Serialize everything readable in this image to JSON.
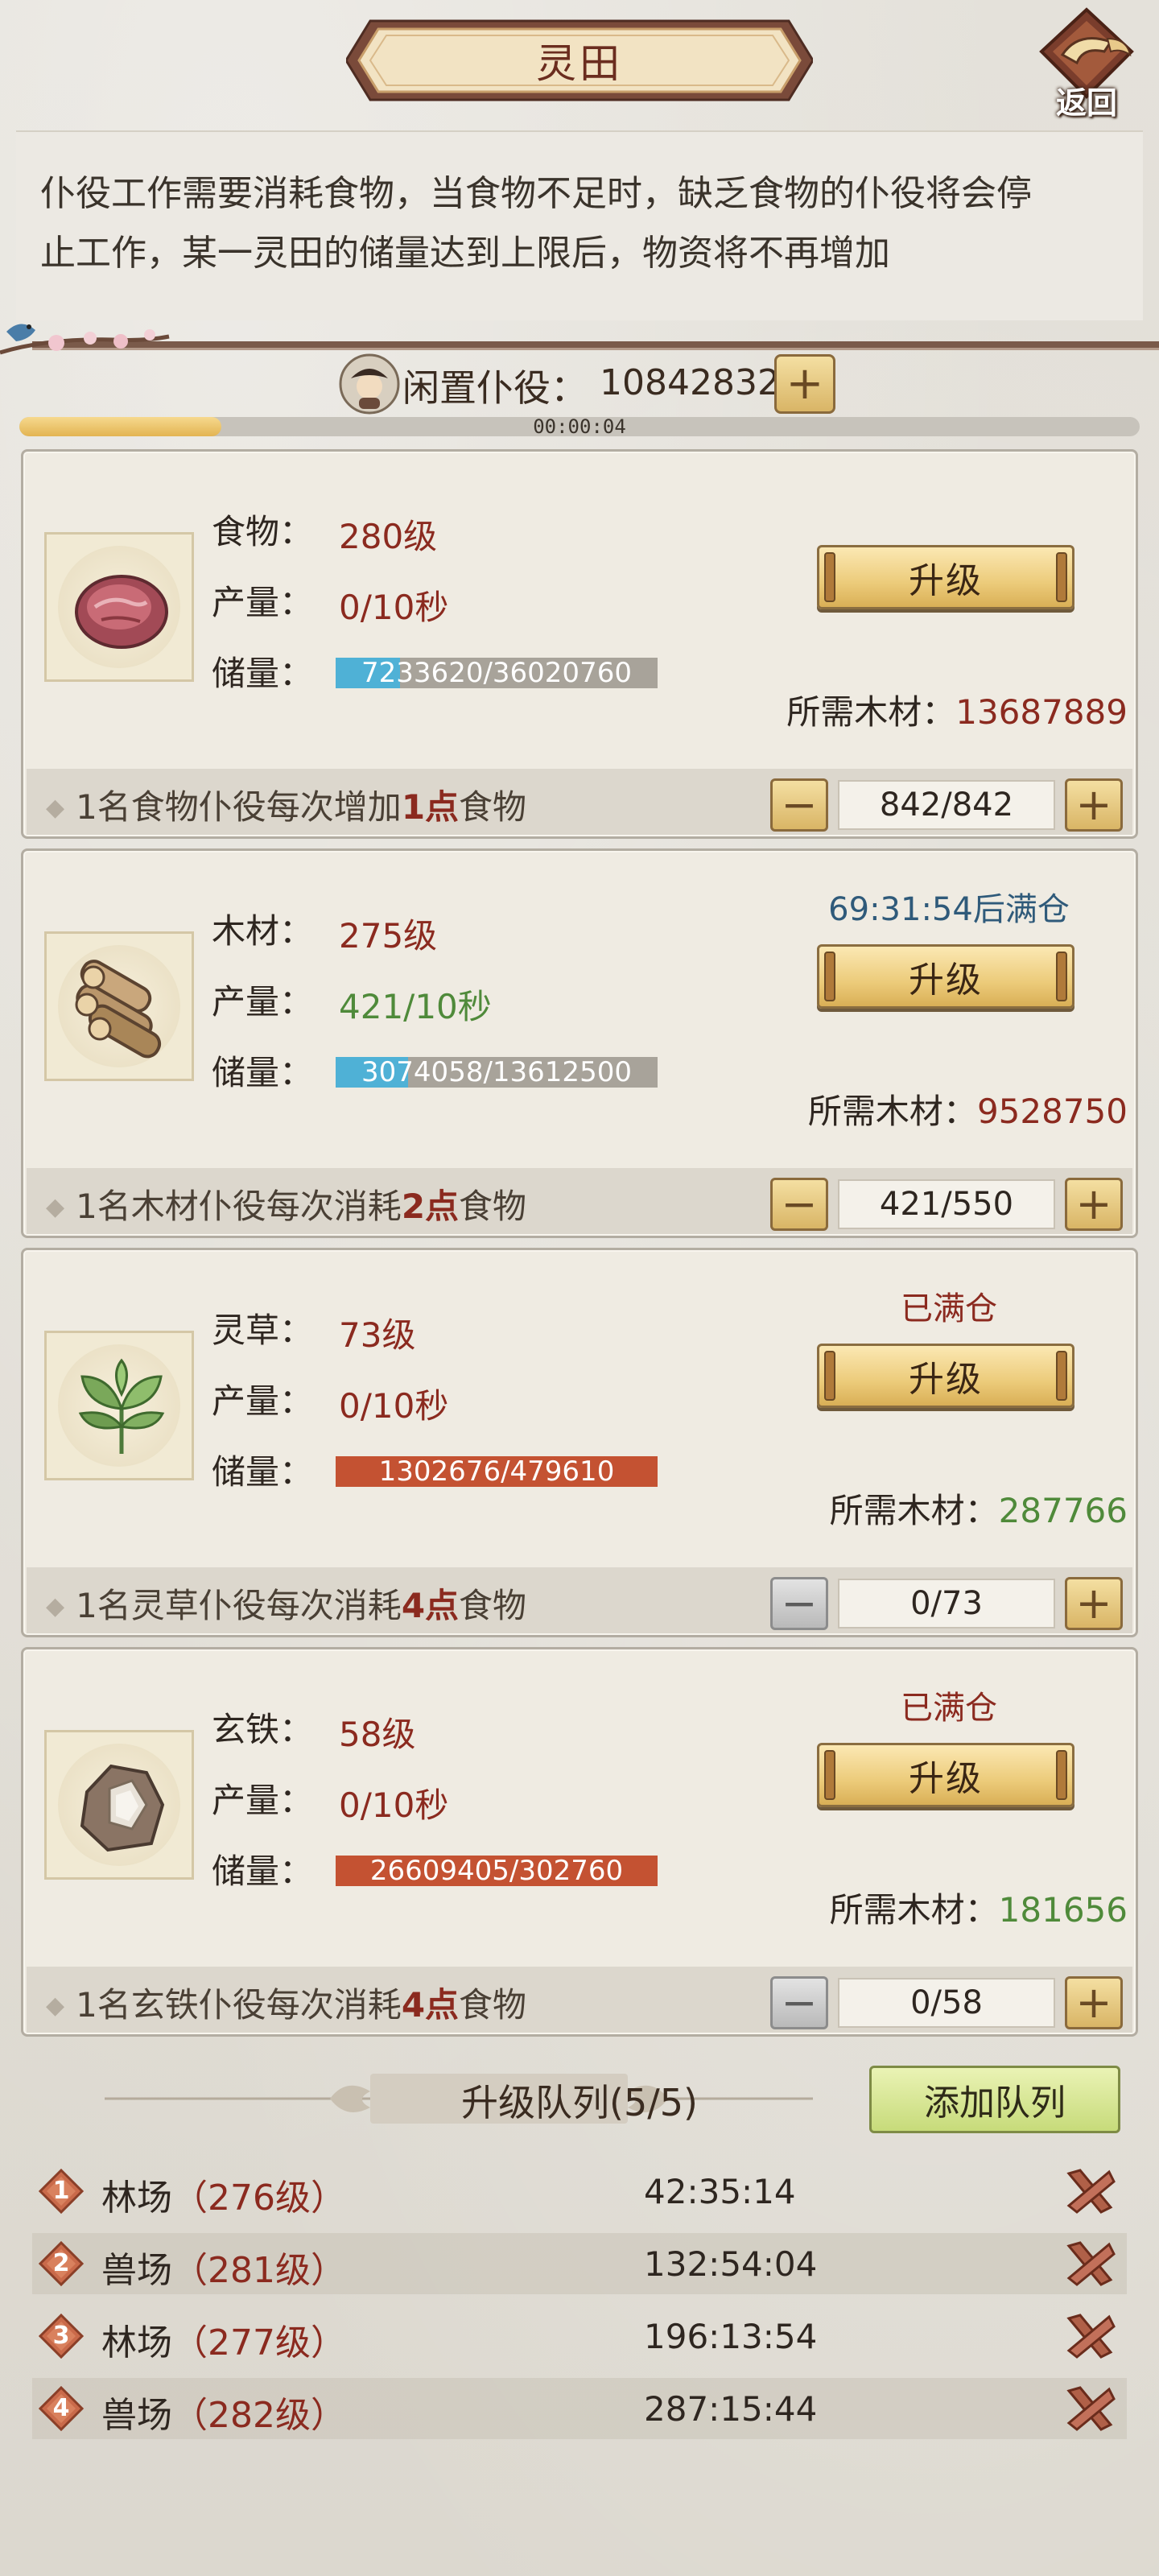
{
  "header": {
    "title": "灵田",
    "back_label": "返回"
  },
  "description": {
    "line1": "仆役工作需要消耗食物，当食物不足时，缺乏食物的仆役将会停",
    "line2": "止工作，某一灵田的储量达到上限后，物资将不再增加"
  },
  "idle": {
    "label": "闲置仆役：",
    "count": "10842832",
    "plus_label": "+",
    "timer": "00:00:04",
    "timer_progress_fraction": 0.18
  },
  "cards": [
    {
      "name_label": "食物：",
      "level": "280级",
      "prod_label": "产量：",
      "production": "0/10秒",
      "production_color": "#8b2a1f",
      "storage_label": "储量：",
      "storage": "7233620/36020760",
      "storage_fraction": 0.2,
      "storage_fill_color": "#4fb1d6",
      "status": "",
      "status_color": "#8b2a1f",
      "upgrade_label": "升级",
      "wood_label": "所需木材：",
      "wood_cost": "13687889",
      "wood_cost_color": "#8b2a1f",
      "footer_pre": "1名食物仆役每次增加",
      "footer_num": "1点",
      "footer_post": "食物",
      "quantity": "842/842",
      "minus_enabled": true
    },
    {
      "name_label": "木材：",
      "level": "275级",
      "prod_label": "产量：",
      "production": "421/10秒",
      "production_color": "#4f8a3a",
      "storage_label": "储量：",
      "storage": "3074058/13612500",
      "storage_fraction": 0.226,
      "storage_fill_color": "#4fb1d6",
      "status": "69:31:54后满仓",
      "status_color": "#2f5a7a",
      "upgrade_label": "升级",
      "wood_label": "所需木材：",
      "wood_cost": "9528750",
      "wood_cost_color": "#8b2a1f",
      "footer_pre": "1名木材仆役每次消耗",
      "footer_num": "2点",
      "footer_post": "食物",
      "quantity": "421/550",
      "minus_enabled": true
    },
    {
      "name_label": "灵草：",
      "level": "73级",
      "prod_label": "产量：",
      "production": "0/10秒",
      "production_color": "#8b2a1f",
      "storage_label": "储量：",
      "storage": "1302676/479610",
      "storage_fraction": 1.0,
      "storage_fill_color": "#c45232",
      "status": "已满仓",
      "status_color": "#8b2a1f",
      "upgrade_label": "升级",
      "wood_label": "所需木材：",
      "wood_cost": "287766",
      "wood_cost_color": "#4f8a3a",
      "footer_pre": "1名灵草仆役每次消耗",
      "footer_num": "4点",
      "footer_post": "食物",
      "quantity": "0/73",
      "minus_enabled": false
    },
    {
      "name_label": "玄铁：",
      "level": "58级",
      "prod_label": "产量：",
      "production": "0/10秒",
      "production_color": "#8b2a1f",
      "storage_label": "储量：",
      "storage": "26609405/302760",
      "storage_fraction": 1.0,
      "storage_fill_color": "#c45232",
      "status": "已满仓",
      "status_color": "#8b2a1f",
      "upgrade_label": "升级",
      "wood_label": "所需木材：",
      "wood_cost": "181656",
      "wood_cost_color": "#4f8a3a",
      "footer_pre": "1名玄铁仆役每次消耗",
      "footer_num": "4点",
      "footer_post": "食物",
      "quantity": "0/58",
      "minus_enabled": false
    }
  ],
  "queue": {
    "title": "升级队列(5/5)",
    "add_label": "添加队列",
    "items": [
      {
        "num": "1",
        "name": "林场",
        "lvl": "（276级）",
        "time": "42:35:14"
      },
      {
        "num": "2",
        "name": "兽场",
        "lvl": "（281级）",
        "time": "132:54:04"
      },
      {
        "num": "3",
        "name": "林场",
        "lvl": "（277级）",
        "time": "196:13:54"
      },
      {
        "num": "4",
        "name": "兽场",
        "lvl": "（282级）",
        "time": "287:15:44"
      }
    ]
  },
  "icons": {
    "back": "back-arrow-icon",
    "idle": "servant-avatar-icon",
    "food": "meat-icon",
    "wood": "log-pile-icon",
    "herb": "herb-leaf-icon",
    "iron": "iron-ore-icon",
    "cancel": "cross-icon"
  },
  "colors": {
    "level_red": "#8b2a1f",
    "green": "#4f8a3a",
    "blue_status": "#2f5a7a"
  }
}
